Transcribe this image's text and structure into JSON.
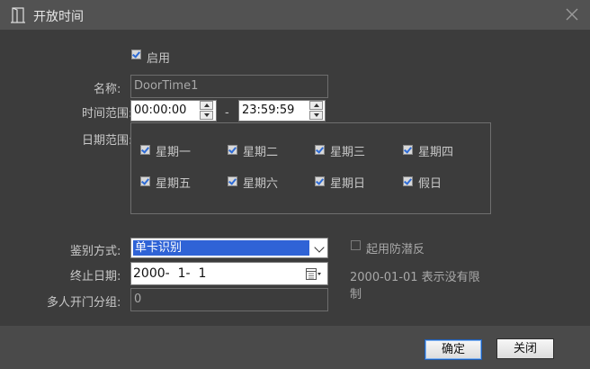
{
  "window": {
    "title": "开放时间",
    "icon": "door-icon",
    "close_icon": "close-icon"
  },
  "enable": {
    "label": "启用",
    "checked": true
  },
  "name": {
    "label": "名称:",
    "value": "DoorTime1"
  },
  "time_range": {
    "label": "时间范围:",
    "start": "00:00:00",
    "separator": "-",
    "end": "23:59:59"
  },
  "date_range": {
    "label": "日期范围:",
    "days": [
      {
        "label": "星期一",
        "checked": true
      },
      {
        "label": "星期二",
        "checked": true
      },
      {
        "label": "星期三",
        "checked": true
      },
      {
        "label": "星期四",
        "checked": true
      },
      {
        "label": "星期五",
        "checked": true
      },
      {
        "label": "星期六",
        "checked": true
      },
      {
        "label": "星期日",
        "checked": true
      },
      {
        "label": "假日",
        "checked": true
      }
    ]
  },
  "auth_mode": {
    "label": "鉴别方式:",
    "value": "单卡识别"
  },
  "anti_passback": {
    "label": "起用防潜反",
    "checked": false
  },
  "end_date": {
    "label": "终止日期:",
    "value": "2000-  1-  1",
    "calendar_icon": "calendar-icon"
  },
  "end_date_note": "2000-01-01 表示没有限制",
  "group": {
    "label": "多人开门分组:",
    "value": "0"
  },
  "buttons": {
    "ok": "确定",
    "close": "关闭"
  }
}
